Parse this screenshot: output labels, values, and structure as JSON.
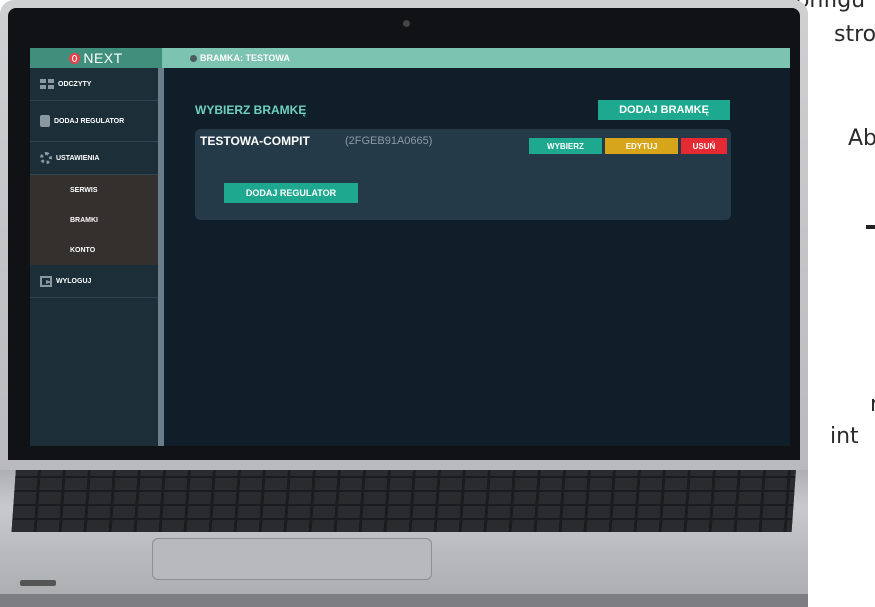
{
  "background_text": {
    "line1": "konfigu",
    "line2": "stro",
    "line3": "Ab",
    "line4": "r",
    "line5": "int"
  },
  "app": {
    "logo": "NEXT",
    "breadcrumb": "BRAMKA: TESTOWA"
  },
  "sidebar": {
    "items": [
      {
        "label": "ODCZYTY",
        "icon": "grid-icon"
      },
      {
        "label": "DODAJ REGULATOR",
        "icon": "device-icon"
      },
      {
        "label": "USTAWIENIA",
        "icon": "gear-icon"
      }
    ],
    "subitems": [
      "SERWIS",
      "BRAMKI",
      "KONTO"
    ],
    "logout": {
      "label": "WYLOGUJ",
      "icon": "logout-icon"
    }
  },
  "main": {
    "title": "WYBIERZ BRAMKĘ",
    "add_gateway_label": "DODAJ BRAMKĘ",
    "gateway": {
      "name": "TESTOWA-COMPIT",
      "id": "(2FGEB91A0665)",
      "select_label": "WYBIERZ",
      "edit_label": "EDYTUJ",
      "delete_label": "USUŃ",
      "add_regulator_label": "DODAJ REGULATOR"
    }
  },
  "colors": {
    "accent": "#1fa890",
    "topbar": "#7cc4b0",
    "edit": "#d7a51a",
    "delete": "#e62a34",
    "sidebar": "#1c2e38",
    "main_bg": "#0f1e28"
  }
}
